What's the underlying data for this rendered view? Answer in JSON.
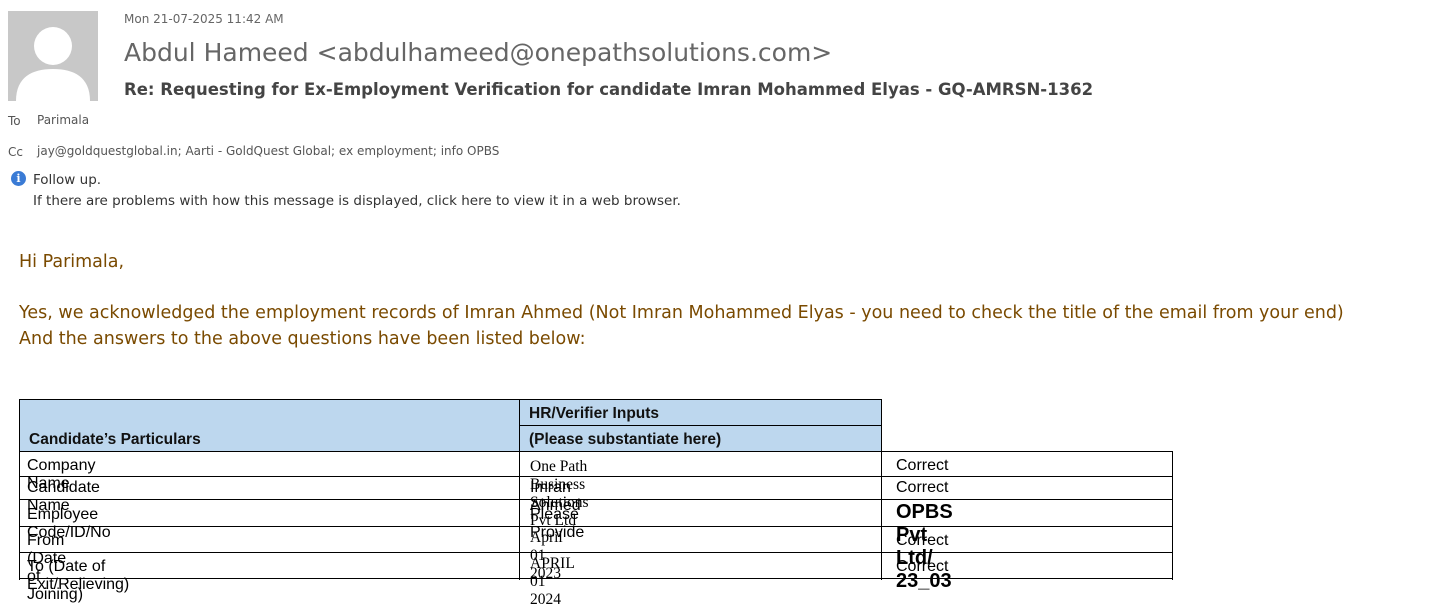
{
  "header": {
    "date": "Mon 21-07-2025 11:42 AM",
    "from": "Abdul Hameed <abdulhameed@onepathsolutions.com>",
    "subject": "Re: Requesting for Ex-Employment Verification for candidate Imran Mohammed Elyas - GQ-AMRSN-1362",
    "to_label": "To",
    "to_value": "Parimala",
    "cc_label": "Cc",
    "cc_value": "jay@goldquestglobal.in; Aarti - GoldQuest Global; ex employment; info OPBS"
  },
  "infobar": {
    "followup": "Follow up.",
    "browser_notice": "If there are problems with how this message is displayed, click here to view it in a web browser."
  },
  "body": {
    "greeting": "Hi Parimala,",
    "line1": "Yes, we acknowledged the employment records of Imran Ahmed (Not Imran Mohammed Elyas - you need to check the title of the email from your end)",
    "line2": "And the answers to the above questions have been listed below:"
  },
  "table": {
    "head_col1": "Candidate’s Particulars",
    "head_col2_line1": "HR/Verifier Inputs",
    "head_col2_line2": "(Please substantiate here)",
    "rows": [
      {
        "particular": "Company Name",
        "input": "One Path Business Solutions Pvt Ltd",
        "status": "Correct"
      },
      {
        "particular": "Candidate Name",
        "input": "Imran Ahmed",
        "status": "Correct"
      },
      {
        "particular": "Employee Code/ID/No",
        "input": "Please Provide",
        "status": "OPBS Pvt Ltd/ 23_03"
      },
      {
        "particular": "From (Date of Joining)",
        "input": "April 01 2023",
        "status": "Correct"
      },
      {
        "particular": "To (Date of Exit/Relieving)",
        "input": "APRIL 01 2024",
        "status": "Correct"
      }
    ]
  },
  "colors": {
    "body_text": "#7a4a00",
    "table_header": "#bdd7ee",
    "info_icon": "#3a7bd5"
  }
}
